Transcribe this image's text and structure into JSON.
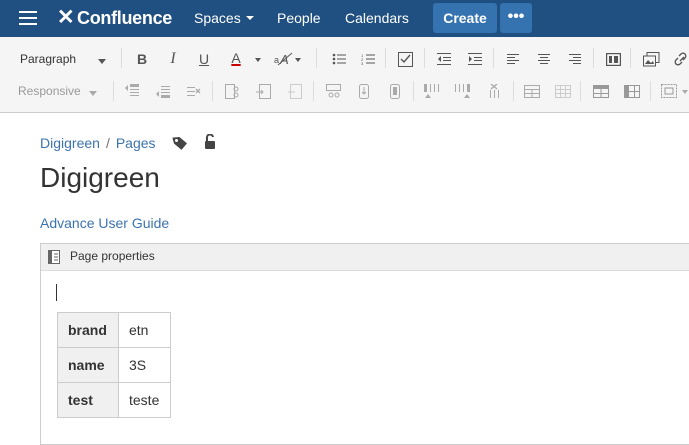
{
  "nav": {
    "logo": "Confluence",
    "spaces": "Spaces",
    "people": "People",
    "calendars": "Calendars",
    "create": "Create",
    "more": "•••"
  },
  "toolbar": {
    "paragraph": "Paragraph",
    "responsive": "Responsive",
    "bold": "B",
    "italic": "I",
    "underline": "U",
    "text_color": "A"
  },
  "breadcrumb": {
    "space": "Digigreen",
    "pages": "Pages"
  },
  "page": {
    "title": "Digigreen",
    "link": "Advance User Guide"
  },
  "macro": {
    "title": "Page properties",
    "rows": [
      {
        "key": "brand",
        "value": "etn"
      },
      {
        "key": "name",
        "value": "3S"
      },
      {
        "key": "test",
        "value": "teste"
      }
    ]
  }
}
